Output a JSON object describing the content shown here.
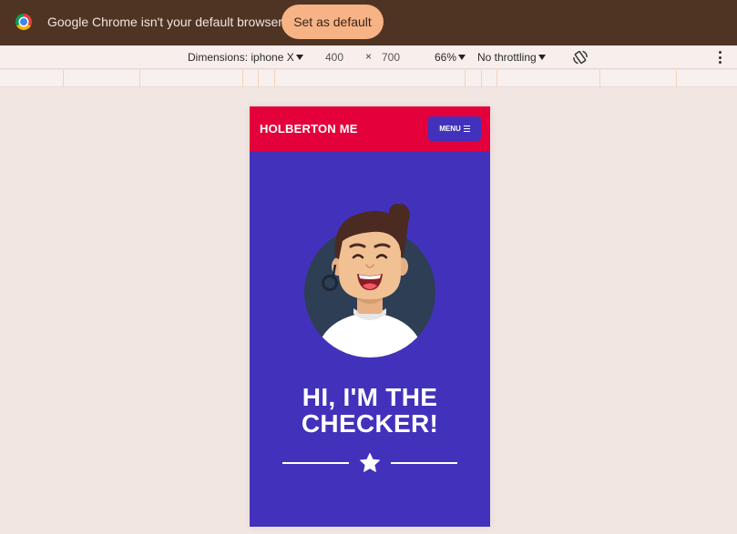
{
  "infobar": {
    "message": "Google Chrome isn't your default browser",
    "button_label": "Set as default"
  },
  "devtools": {
    "dimensions_label": "Dimensions: iphone X",
    "width": "400",
    "times": "×",
    "height": "700",
    "zoom": "66%",
    "throttling": "No throttling",
    "icons": [
      "rotate-icon",
      "more-vert-icon",
      "dropdown-arrow-icon"
    ]
  },
  "site": {
    "title": "HOLBERTON ME",
    "menu_label": "MENU",
    "headline_line1": "HI, I'M THE",
    "headline_line2": "CHECKER!",
    "colors": {
      "header": "#e4003a",
      "background": "#4232bb",
      "text": "#ffffff"
    },
    "icons": [
      "menu-icon",
      "avatar-illustration",
      "star-icon"
    ]
  }
}
